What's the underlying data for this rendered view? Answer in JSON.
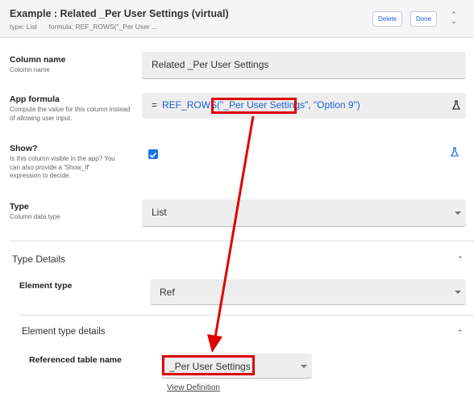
{
  "header": {
    "title": "Example : Related _Per User Settings (virtual)",
    "type_label": "type: List",
    "formula_label": "formula: REF_ROWS(\"_Per User ...",
    "delete_label": "Delete",
    "done_label": "Done"
  },
  "column_name": {
    "label": "Column name",
    "description": "Column name",
    "value": "Related _Per User Settings"
  },
  "app_formula": {
    "label": "App formula",
    "description": "Compute the value for this column instead of allowing user input.",
    "eq": "=",
    "fn": "REF_ROWS(",
    "arg1": "\"_Per User Settings\"",
    "sep": ", ",
    "arg2": "\"Option 9\")"
  },
  "show": {
    "label": "Show?",
    "description": "Is this column visible in the app? You can also provide a 'Show_If' expression to decide.",
    "checked": true
  },
  "type": {
    "label": "Type",
    "description": "Column data type",
    "value": "List"
  },
  "type_details": {
    "title": "Type Details",
    "element_type_label": "Element type",
    "element_type_value": "Ref",
    "element_type_details_title": "Element type details",
    "referenced_table_label": "Referenced table name",
    "referenced_table_value": "_Per User Settings",
    "view_definition_label": "View Definition"
  },
  "colors": {
    "accent": "#1a73e8",
    "annotation": "#e00000"
  }
}
